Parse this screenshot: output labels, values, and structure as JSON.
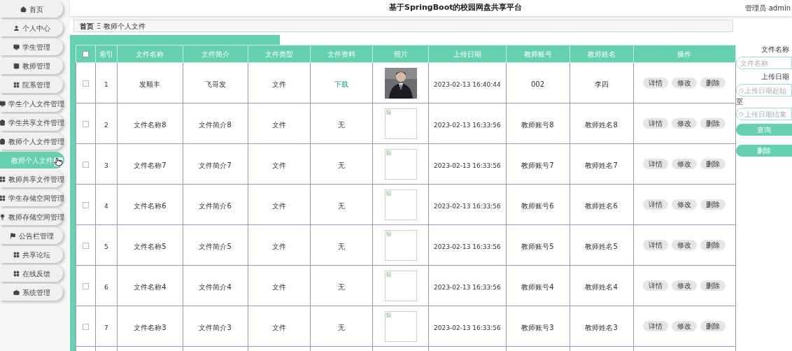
{
  "header": {
    "title": "基于SpringBoot的校园网盘共享平台",
    "user": "管理员 admin"
  },
  "sidebar": {
    "items": [
      {
        "label": "首页",
        "selected": false
      },
      {
        "label": "个人中心",
        "selected": false
      },
      {
        "label": "学生管理",
        "selected": false
      },
      {
        "label": "教师管理",
        "selected": false
      },
      {
        "label": "院系管理",
        "selected": false
      },
      {
        "label": "学生个人文件管理",
        "selected": false
      },
      {
        "label": "学生共享文件管理",
        "selected": false
      },
      {
        "label": "教师个人文件管理",
        "selected": false
      },
      {
        "label": "教师个人文件",
        "selected": true
      },
      {
        "label": "教师共享文件管理",
        "selected": false
      },
      {
        "label": "学生存储空间管理",
        "selected": false
      },
      {
        "label": "教师存储空间管理",
        "selected": false
      },
      {
        "label": "公告栏管理",
        "selected": false
      },
      {
        "label": "共享论坛",
        "selected": false
      },
      {
        "label": "在线反馈",
        "selected": false
      },
      {
        "label": "系统管理",
        "selected": false
      }
    ]
  },
  "breadcrumb": {
    "home": "首页",
    "separator": "Ξ",
    "current": "教师个人文件"
  },
  "table": {
    "all_checked": false,
    "columns": [
      "索引",
      "文件名称",
      "文件简介",
      "文件类型",
      "文件资料",
      "照片",
      "上传日期",
      "教师账号",
      "教师姓名",
      "操作"
    ],
    "rows": [
      {
        "checked": false,
        "index": "1",
        "name": "发顺丰",
        "intro": "飞哥发",
        "type": "文件",
        "file": {
          "kind": "link",
          "text": "下载"
        },
        "date": "2023-02-13 16:40:44",
        "account": "002",
        "teacher": "李四",
        "actions": [
          "详情",
          "修改",
          "删除"
        ]
      },
      {
        "checked": false,
        "index": "2",
        "name": "文件名称8",
        "intro": "文件简介8",
        "type": "文件",
        "file": {
          "kind": "text",
          "text": "无"
        },
        "photo": {
          "kind": "broken"
        },
        "date": "2023-02-13 16:33:56",
        "account": "教师账号8",
        "teacher": "教师姓名8",
        "actions": [
          "详情",
          "修改",
          "删除"
        ]
      },
      {
        "checked": false,
        "index": "3",
        "name": "文件名称7",
        "intro": "文件简介7",
        "type": "文件",
        "file": {
          "kind": "text",
          "text": "无"
        },
        "photo": {
          "kind": "broken"
        },
        "date": "2023-02-13 16:33:56",
        "account": "教师账号7",
        "teacher": "教师姓名7",
        "actions": [
          "详情",
          "修改",
          "删除"
        ]
      },
      {
        "checked": false,
        "index": "4",
        "name": "文件名称6",
        "intro": "文件简介6",
        "type": "文件",
        "file": {
          "kind": "text",
          "text": "无"
        },
        "photo": {
          "kind": "broken"
        },
        "date": "2023-02-13 16:33:56",
        "account": "教师账号6",
        "teacher": "教师姓名6",
        "actions": [
          "详情",
          "修改",
          "删除"
        ]
      },
      {
        "checked": false,
        "index": "5",
        "name": "文件名称5",
        "intro": "文件简介5",
        "type": "文件",
        "file": {
          "kind": "text",
          "text": "无"
        },
        "photo": {
          "kind": "broken"
        },
        "date": "2023-02-13 16:33:56",
        "account": "教师账号5",
        "teacher": "教师姓名5",
        "actions": [
          "详情",
          "修改",
          "删除"
        ]
      },
      {
        "checked": false,
        "index": "6",
        "name": "文件名称4",
        "intro": "文件简介4",
        "type": "文件",
        "file": {
          "kind": "text",
          "text": "无"
        },
        "photo": {
          "kind": "broken"
        },
        "date": "2023-02-13 16:33:56",
        "account": "教师账号4",
        "teacher": "教师姓名4",
        "actions": [
          "详情",
          "修改",
          "删除"
        ]
      },
      {
        "checked": false,
        "index": "7",
        "name": "文件名称3",
        "intro": "文件简介3",
        "type": "文件",
        "file": {
          "kind": "text",
          "text": "无"
        },
        "photo": {
          "kind": "broken"
        },
        "date": "2023-02-13 16:33:56",
        "account": "教师账号3",
        "teacher": "教师姓名3",
        "actions": [
          "详情",
          "修改",
          "删除"
        ]
      }
    ]
  },
  "search": {
    "name_label": "文件名称",
    "name_placeholder": "文件名称",
    "date_label": "上传日期",
    "start_placeholder": "上传日期起始",
    "to": "至",
    "end_placeholder": "上传日期结束",
    "buttons": [
      "查询",
      "删除"
    ]
  }
}
